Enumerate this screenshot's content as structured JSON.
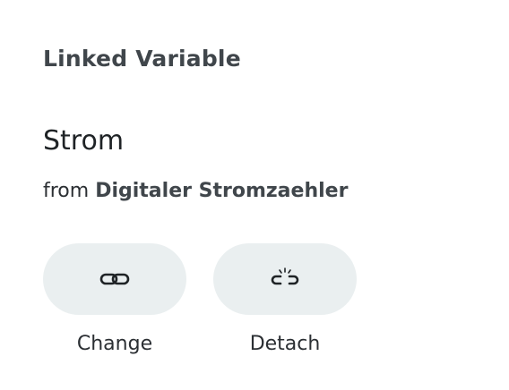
{
  "panel": {
    "title": "Linked Variable",
    "variable_name": "Strom",
    "source_prefix": "from",
    "source_device": "Digitaler Stromzaehler"
  },
  "actions": [
    {
      "label": "Change",
      "icon": "link-icon"
    },
    {
      "label": "Detach",
      "icon": "unlink-icon"
    }
  ],
  "colors": {
    "button_bg": "#eaeff0",
    "title_text": "#40464b",
    "body_text": "#2b2f33"
  }
}
